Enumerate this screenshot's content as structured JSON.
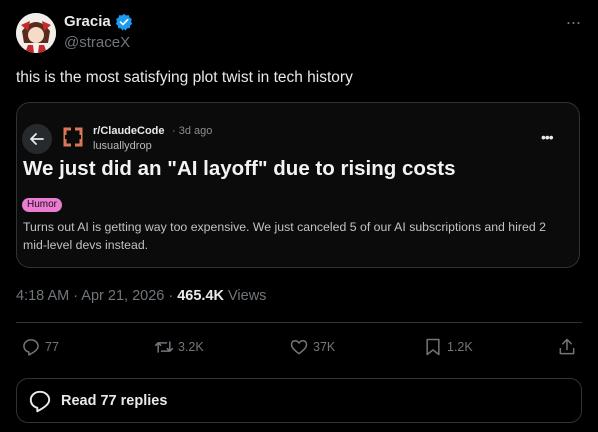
{
  "author": {
    "name": "Gracia",
    "handle": "@straceX"
  },
  "tweet": {
    "text": "this is the most satisfying plot twist in tech history"
  },
  "embedded_post": {
    "subreddit": "r/ClaudeCode",
    "time": "· 3d ago",
    "user": "lusuallydrop",
    "title": "We just did an \"AI layoff\" due to rising costs",
    "flair": "Humor",
    "body": "Turns out AI is getting way too expensive. We just canceled 5 of our AI subscriptions and hired 2 mid-level devs instead."
  },
  "meta": {
    "time": "4:18 AM · Apr 21, 2026 · ",
    "views": "465.4K",
    "views_label": " Views"
  },
  "actions": {
    "replies": "77",
    "reposts": "3.2K",
    "likes": "37K",
    "bookmarks": "1.2K"
  },
  "read_replies": "Read 77 replies",
  "colors": {
    "verified": "#1d9bf0",
    "flair": "#ea7dd0",
    "icon": "#71767b"
  }
}
